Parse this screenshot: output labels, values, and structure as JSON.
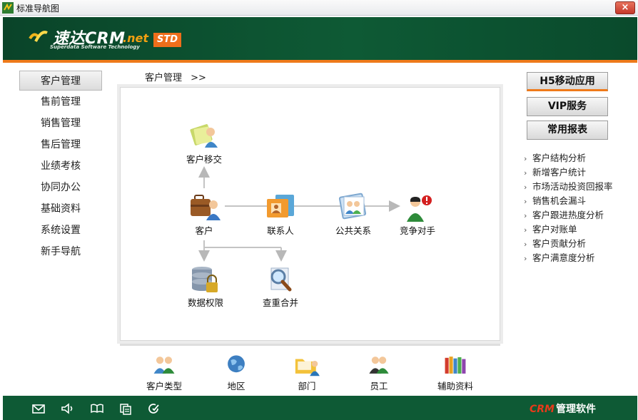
{
  "window": {
    "title": "标准导航图",
    "close_label": "×"
  },
  "header": {
    "brand_name": "速达CRM",
    "brand_suffix": ".net",
    "brand_sub": "Superdata Software Technology",
    "badge": "STD",
    "colors": {
      "bar": "#0e5a35",
      "accent": "#ef7a1a"
    }
  },
  "left_nav": {
    "items": [
      {
        "label": "客户管理",
        "active": true
      },
      {
        "label": "售前管理"
      },
      {
        "label": "销售管理"
      },
      {
        "label": "售后管理"
      },
      {
        "label": "业绩考核"
      },
      {
        "label": "协同办公"
      },
      {
        "label": "基础资料"
      },
      {
        "label": "系统设置"
      },
      {
        "label": "新手导航"
      }
    ]
  },
  "breadcrumb": {
    "label": "客户管理",
    "arrow": ">>"
  },
  "diagram": {
    "nodes": {
      "transfer": {
        "label": "客户移交",
        "icon": "transfer-icon"
      },
      "customer": {
        "label": "客户",
        "icon": "briefcase-person-icon"
      },
      "contact": {
        "label": "联系人",
        "icon": "contact-cards-icon"
      },
      "pr": {
        "label": "公共关系",
        "icon": "public-relations-icon"
      },
      "competitor": {
        "label": "竞争对手",
        "icon": "competitor-alert-icon"
      },
      "permission": {
        "label": "数据权限",
        "icon": "database-lock-icon"
      },
      "dedupe": {
        "label": "查重合并",
        "icon": "magnify-search-icon"
      }
    }
  },
  "bottom_items": [
    {
      "label": "客户类型",
      "icon": "customer-type-icon"
    },
    {
      "label": "地区",
      "icon": "globe-icon"
    },
    {
      "label": "部门",
      "icon": "department-folder-icon"
    },
    {
      "label": "员工",
      "icon": "employee-icon"
    },
    {
      "label": "辅助资料",
      "icon": "books-icon"
    }
  ],
  "right_panel": {
    "buttons": [
      "H5移动应用",
      "VIP服务",
      "常用报表"
    ],
    "reports": [
      "客户结构分析",
      "新增客户统计",
      "市场活动投资回报率",
      "销售机会漏斗",
      "客户跟进热度分析",
      "客户对账单",
      "客户贡献分析",
      "客户满意度分析"
    ]
  },
  "footer": {
    "brand_crm": "CRM",
    "brand_text": "管理软件",
    "icons": [
      "mail-icon",
      "speaker-icon",
      "book-icon",
      "copy-icon",
      "refresh-check-icon"
    ]
  }
}
